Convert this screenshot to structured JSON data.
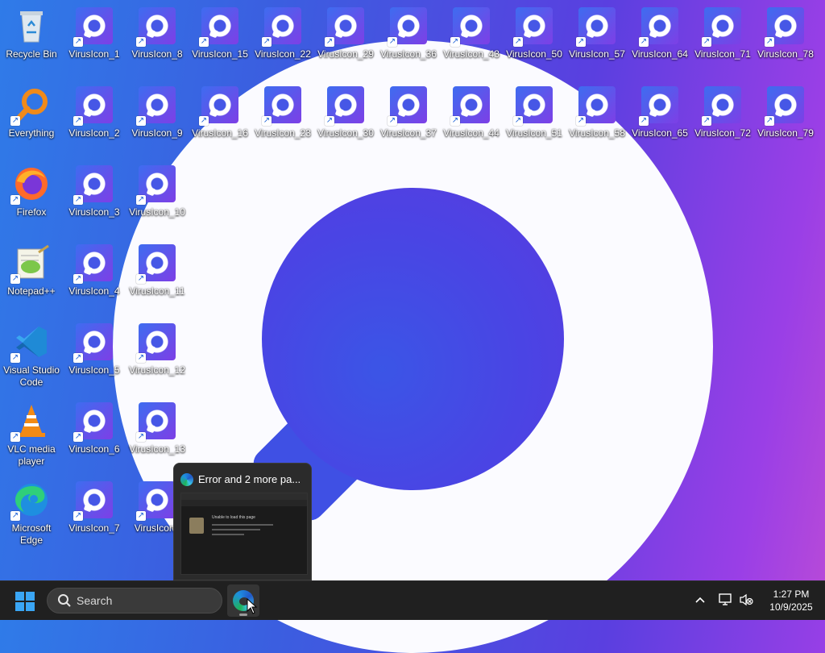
{
  "desktop": {
    "system_icons": [
      {
        "label": "Recycle Bin",
        "icon": "recycle-bin-icon"
      },
      {
        "label": "Everything",
        "icon": "everything-search-icon"
      },
      {
        "label": "Firefox",
        "icon": "firefox-icon"
      },
      {
        "label": "Notepad++",
        "icon": "notepadpp-icon"
      },
      {
        "label": "Visual Studio Code",
        "icon": "vscode-icon"
      },
      {
        "label": "VLC media player",
        "icon": "vlc-icon"
      },
      {
        "label": "Microsoft Edge",
        "icon": "edge-icon"
      }
    ],
    "virus_icons": [
      "VirusIcon_1",
      "VirusIcon_8",
      "VirusIcon_15",
      "VirusIcon_22",
      "VirusIcon_29",
      "VirusIcon_36",
      "VirusIcon_43",
      "VirusIcon_50",
      "VirusIcon_57",
      "VirusIcon_64",
      "VirusIcon_71",
      "VirusIcon_78",
      "VirusIcon_2",
      "VirusIcon_9",
      "VirusIcon_16",
      "VirusIcon_23",
      "VirusIcon_30",
      "VirusIcon_37",
      "VirusIcon_44",
      "VirusIcon_51",
      "VirusIcon_58",
      "VirusIcon_65",
      "VirusIcon_72",
      "VirusIcon_79",
      "VirusIcon_3",
      "VirusIcon_10",
      "VirusIcon_4",
      "VirusIcon_11",
      "VirusIcon_5",
      "VirusIcon_12",
      "VirusIcon_6",
      "VirusIcon_13",
      "VirusIcon_7",
      "VirusIcon_"
    ]
  },
  "preview": {
    "title": "Error and 2 more pa...",
    "page_heading": "Unable to load this page"
  },
  "taskbar": {
    "search_placeholder": "Search",
    "clock_time": "1:27 PM",
    "clock_date": "10/9/2025"
  }
}
